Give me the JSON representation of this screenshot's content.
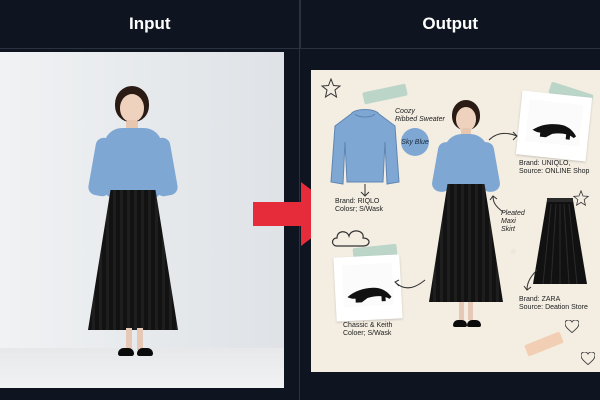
{
  "header": {
    "input_label": "Input",
    "output_label": "Output"
  },
  "icons": {
    "arrow": "red-right-arrow-icon",
    "heart": "heart-icon",
    "star": "star-icon",
    "cloud": "cloud-icon",
    "shoe": "high-heel-icon"
  },
  "colors": {
    "background": "#0f1520",
    "arrow_red": "#e62b3b",
    "sweater_blue": "#7fa7d3",
    "skirt_black": "#121212",
    "paper_beige": "#f3ede2",
    "tape_teal": "#78b9aa"
  },
  "collage": {
    "sweater_title": "Coozy\nRibbed Sweater",
    "color_badge": "Sky Blue",
    "sweater_brand": "Brand: RIQLO\nColosr; S/Wask",
    "shoe_brand_top": "Brand: UNIQLO,\nSource: ONLINE Shop",
    "skirt_title": "Pleated\nMaxi\nSkirt",
    "skirt_brand": "Brand: ZARA\nSource: Deation Store",
    "shoe_brand_bottom": "Chassic & Keith\nColoer; S/Wask"
  }
}
